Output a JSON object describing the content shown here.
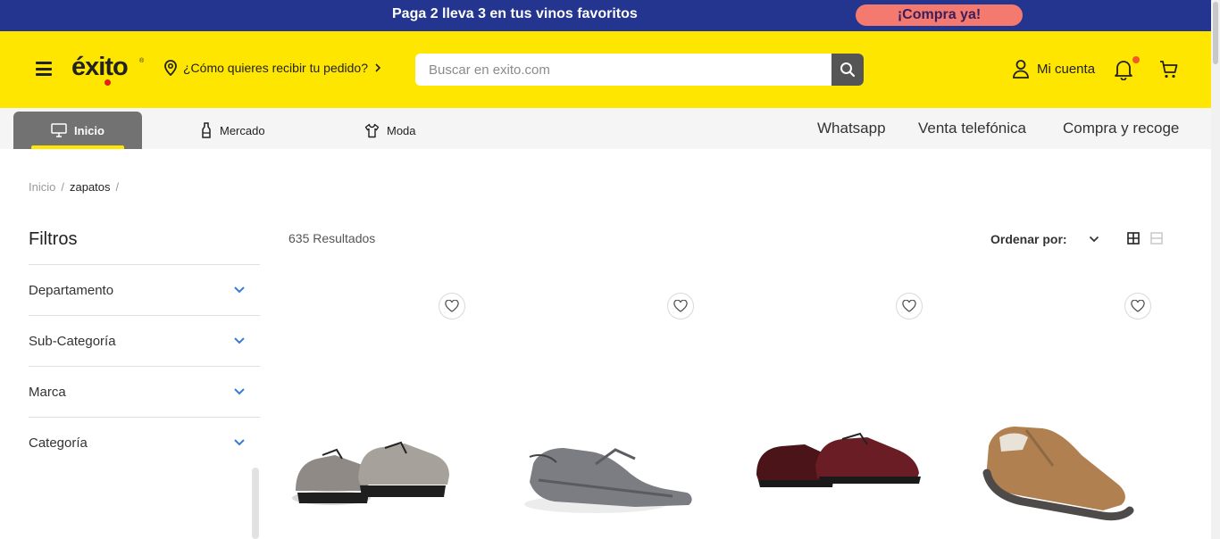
{
  "promo": {
    "text": "Paga 2 lleva 3 en tus vinos favoritos",
    "button": "¡Compra ya!"
  },
  "header": {
    "logo": "éxito",
    "logo_mark": "®",
    "delivery": "¿Cómo quieres recibir tu pedido?",
    "search_placeholder": "Buscar en exito.com",
    "account": "Mi cuenta"
  },
  "nav": {
    "tabs": [
      {
        "label": "Inicio",
        "icon": "monitor-icon",
        "active": true
      },
      {
        "label": "Mercado",
        "icon": "bottle-icon"
      },
      {
        "label": "Moda",
        "icon": "shirt-icon"
      }
    ],
    "links": [
      "Whatsapp",
      "Venta telefónica",
      "Compra y recoge"
    ]
  },
  "breadcrumb": {
    "home": "Inicio",
    "current": "zapatos",
    "sep": "/"
  },
  "filters": {
    "title": "Filtros",
    "items": [
      "Departamento",
      "Sub-Categoría",
      "Marca",
      "Categoría"
    ]
  },
  "results": {
    "count": "635 Resultados",
    "sort_label": "Ordenar por:"
  },
  "colors": {
    "brand_yellow": "#ffe600",
    "promo_blue": "#23358f",
    "promo_btn": "#f47a6f",
    "chevron_blue": "#3a7bd5"
  },
  "products": [
    {
      "icon": "metallic-brogue-shoes"
    },
    {
      "icon": "grey-water-shoes"
    },
    {
      "icon": "burgundy-patent-brogues"
    },
    {
      "icon": "tan-slip-on-shoe"
    }
  ]
}
